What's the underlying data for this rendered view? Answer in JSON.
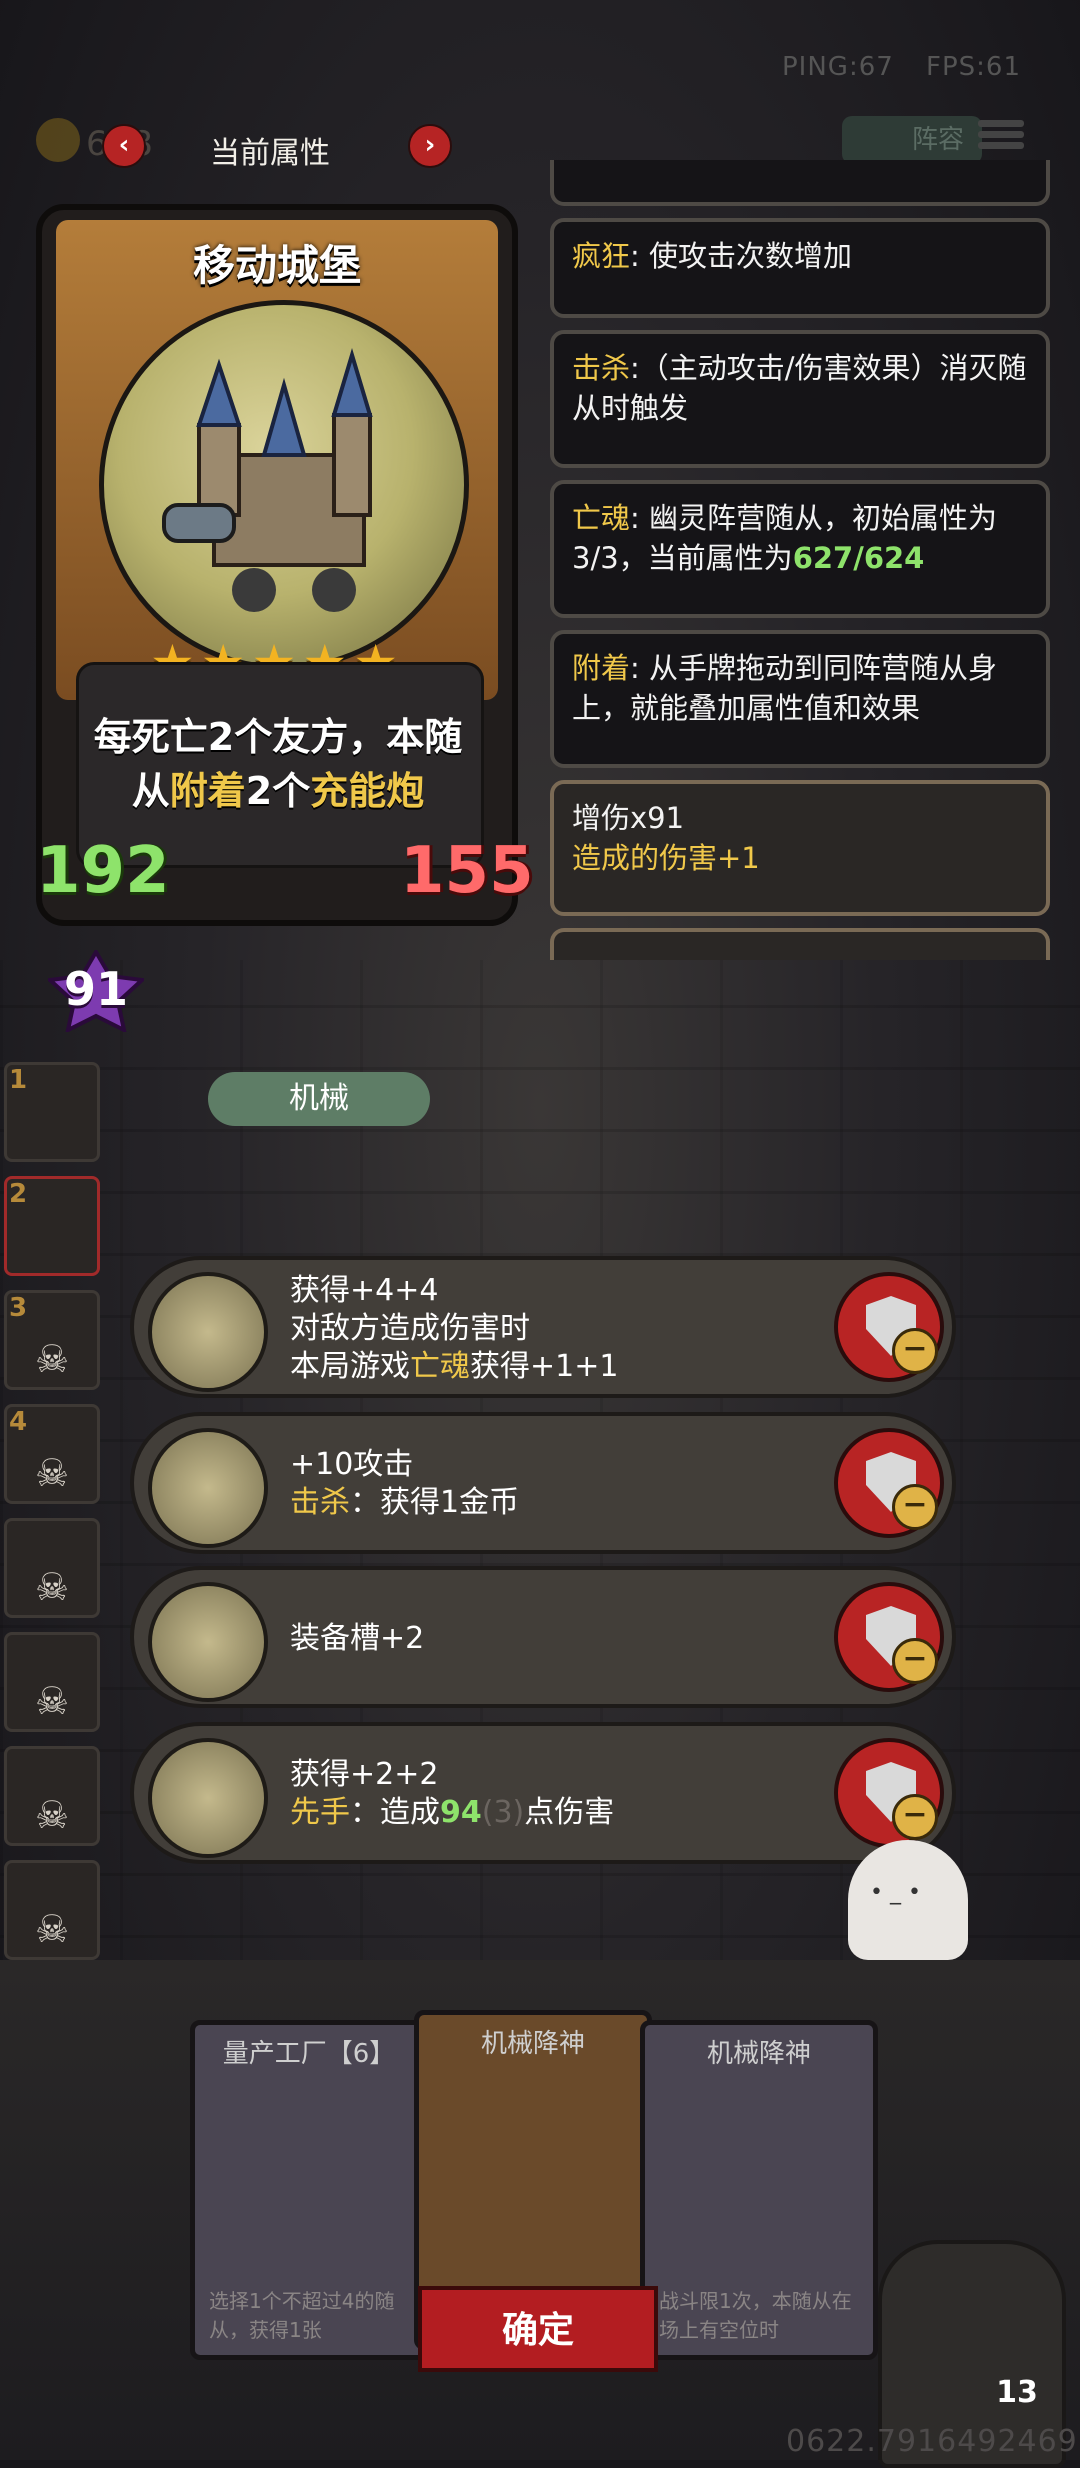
{
  "hud": {
    "ping": "PING:67",
    "fps": "FPS:61",
    "gold": "618",
    "roster_label": "阵容"
  },
  "nav": {
    "title": "当前属性",
    "prev": "‹",
    "next": "›"
  },
  "card": {
    "name": "移动城堡",
    "stars": "★★★★★",
    "desc_pre": "每死亡",
    "desc_n1": "2",
    "desc_mid1": "个友方，本随从",
    "desc_attach": "附着",
    "desc_n2": "2",
    "desc_mid2": "个",
    "desc_item": "充能炮",
    "attack": "192",
    "health": "155",
    "tribe": "机械",
    "buff": "91"
  },
  "keywords": [
    {
      "key": "疯狂",
      "text": ": 使攻击次数增加"
    },
    {
      "key": "击杀",
      "text": ":（主动攻击/伤害效果）消灭随从时触发"
    },
    {
      "key": "亡魂",
      "text_a": ": 幽灵阵营随从，初始属性为3/3，当前属性为",
      "stat": "627/624"
    },
    {
      "key": "附着",
      "text": ": 从手牌拖动到同阵营随从身上，就能叠加属性值和效果"
    }
  ],
  "buff_panel": {
    "title": "增伤x91",
    "detail": "造成的伤害+1"
  },
  "side_slots": [
    "1",
    "2",
    "3",
    "4",
    "",
    "",
    "",
    ""
  ],
  "equipment": [
    {
      "line1": "获得+4+4",
      "line2": "对敌方造成伤害时",
      "line3_pre": "本局游戏",
      "line3_key": "亡魂",
      "line3_post": "获得+1+1",
      "icon": "electric-guitar-icon"
    },
    {
      "line1": "+10攻击",
      "line2_key": "击杀",
      "line2_post": "：获得1金币",
      "icon": "gauntlet-icon"
    },
    {
      "line1": "装备槽+2",
      "icon": "pig-icon"
    },
    {
      "line1": "获得+2+2",
      "line2_key": "先手",
      "line2_mid": "：造成",
      "line2_num": "94",
      "line2_dim": "(3)",
      "line2_post": "点伤害",
      "icon": "crossbow-icon"
    }
  ],
  "bottom_cards": {
    "left_title": "量产工厂【6】",
    "left_text": "选择1个不超过4的随从，获得1张",
    "mid_title": "机械降神",
    "right_title": "机械降神",
    "right_text": "战斗限1次，本随从在场上有空位时"
  },
  "confirm_label": "确定",
  "hero_hp": "13",
  "timestamp": "0622.7916492469",
  "colors": {
    "keyword": "#f0c84a",
    "stat_green": "#8ee36b",
    "health_red": "#ff6a6a",
    "button_red": "#b31d21"
  }
}
